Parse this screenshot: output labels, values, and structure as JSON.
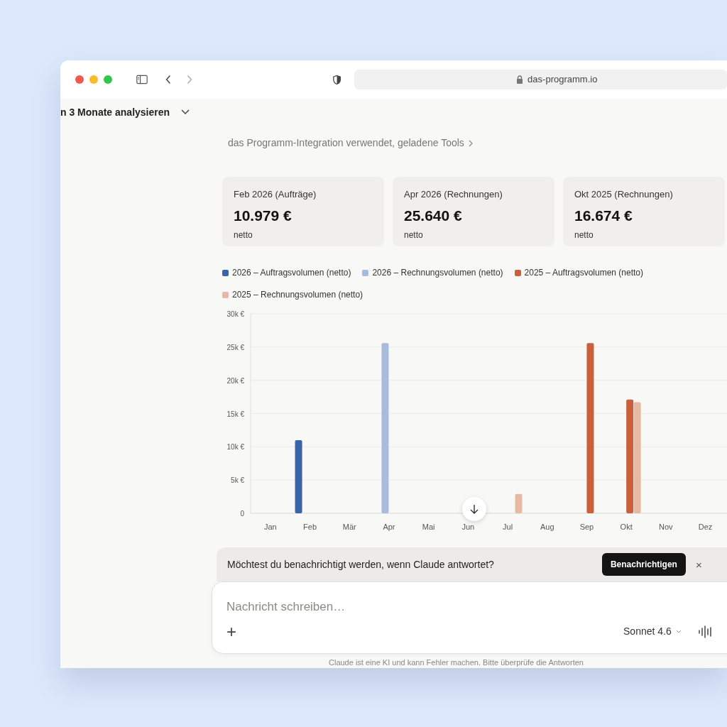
{
  "browser": {
    "url": "das-programm.io"
  },
  "chat": {
    "title": "n 3 Monate analysieren",
    "tools_note": "das Programm-Integration verwendet, geladene Tools"
  },
  "cards": [
    {
      "label": "Feb 2026 (Aufträge)",
      "value": "10.979 €",
      "note": "netto"
    },
    {
      "label": "Apr 2026 (Rechnungen)",
      "value": "25.640 €",
      "note": "netto"
    },
    {
      "label": "Okt 2025 (Rechnungen)",
      "value": "16.674 €",
      "note": "netto"
    }
  ],
  "chart_data": {
    "type": "bar",
    "categories": [
      "Jan",
      "Feb",
      "Mär",
      "Apr",
      "Mai",
      "Jun",
      "Jul",
      "Aug",
      "Sep",
      "Okt",
      "Nov",
      "Dez"
    ],
    "series": [
      {
        "name": "2026 – Auftragsvolumen (netto)",
        "color": "#3a63a8",
        "values": [
          null,
          11000,
          null,
          null,
          null,
          null,
          null,
          null,
          null,
          null,
          null,
          null
        ]
      },
      {
        "name": "2026 – Rechnungsvolumen (netto)",
        "color": "#a8bbdb",
        "values": [
          null,
          null,
          null,
          25600,
          null,
          null,
          null,
          null,
          null,
          null,
          null,
          null
        ]
      },
      {
        "name": "2025 – Auftragsvolumen (netto)",
        "color": "#c9603b",
        "values": [
          null,
          null,
          null,
          null,
          null,
          null,
          null,
          null,
          25600,
          17100,
          null,
          null
        ]
      },
      {
        "name": "2025 – Rechnungsvolumen (netto)",
        "color": "#e6b9a5",
        "values": [
          null,
          null,
          null,
          null,
          null,
          null,
          2900,
          null,
          null,
          16700,
          null,
          null
        ]
      }
    ],
    "grid": true,
    "ylim": [
      0,
      30000
    ],
    "yticks": [
      {
        "value": 0,
        "label": "0"
      },
      {
        "value": 5000,
        "label": "5k €"
      },
      {
        "value": 10000,
        "label": "10k €"
      },
      {
        "value": 15000,
        "label": "15k €"
      },
      {
        "value": 20000,
        "label": "20k €"
      },
      {
        "value": 25000,
        "label": "25k €"
      },
      {
        "value": 30000,
        "label": "30k €"
      }
    ]
  },
  "notify_banner": {
    "text": "Möchtest du benachrichtigt werden, wenn Claude antwortet?",
    "button": "Benachrichtigen",
    "close": "×"
  },
  "composer": {
    "placeholder": "Nachricht schreiben…",
    "add": "+",
    "model": "Sonnet 4.6"
  },
  "disclaimer": "Claude ist eine KI und kann Fehler machen. Bitte überprüfe die Antworten"
}
